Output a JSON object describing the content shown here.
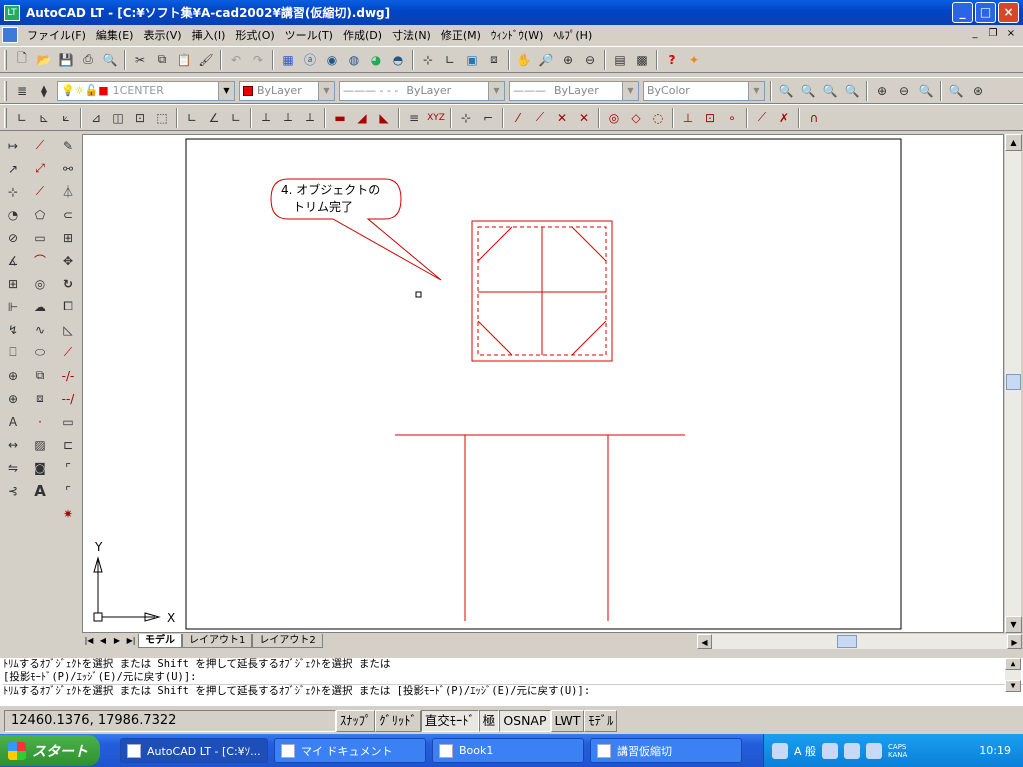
{
  "window": {
    "title": "AutoCAD LT - [C:¥ソフト集¥A-cad2002¥講習(仮縮切).dwg]",
    "app_icon": "LT"
  },
  "menu": {
    "items": [
      "ファイル(F)",
      "編集(E)",
      "表示(V)",
      "挿入(I)",
      "形式(O)",
      "ツール(T)",
      "作成(D)",
      "寸法(N)",
      "修正(M)",
      "ｳｨﾝﾄﾞｳ(W)",
      "ﾍﾙﾌﾟ(H)"
    ]
  },
  "layers": {
    "layer_name": "1CENTER",
    "color": "ByLayer",
    "linetype": "ByLayer",
    "lineweight": "ByLayer",
    "plotstyle": "ByColor"
  },
  "drawing": {
    "callout_text_line1": "4. オブジェクトの",
    "callout_text_line2": "トリム完了",
    "axis_x": "X",
    "axis_y": "Y",
    "line_color": "#e00000"
  },
  "tabs": {
    "model": "モデル",
    "layout1": "レイアウト1",
    "layout2": "レイアウト2"
  },
  "command": {
    "line1": "ﾄﾘﾑするｵﾌﾞｼﾞｪｸﾄを選択 または Shift を押して延長するｵﾌﾞｼﾞｪｸﾄを選択 または",
    "line2": "[投影ﾓｰﾄﾞ(P)/ｴｯｼﾞ(E)/元に戻す(U)]:",
    "line3": "ﾄﾘﾑするｵﾌﾞｼﾞｪｸﾄを選択 または Shift を押して延長するｵﾌﾞｼﾞｪｸﾄを選択 または [投影ﾓｰﾄﾞ(P)/ｴｯｼﾞ(E)/元に戻す(U)]:"
  },
  "status": {
    "coords": "12460.1376, 17986.7322",
    "snap": "ｽﾅｯﾌﾟ",
    "grid": "ｸﾞﾘｯﾄﾞ",
    "ortho": "直交ﾓｰﾄﾞ",
    "polar": "極",
    "osnap": "OSNAP",
    "lwt": "LWT",
    "model": "ﾓﾃﾞﾙ"
  },
  "taskbar": {
    "start": "スタート",
    "tasks": [
      "AutoCAD LT - [C:¥ｿ...",
      "マイ ドキュメント",
      "Book1",
      "講習仮縮切"
    ],
    "clock": "10:19",
    "caps": "CAPS",
    "kana": "KANA",
    "ime": "A 般"
  }
}
